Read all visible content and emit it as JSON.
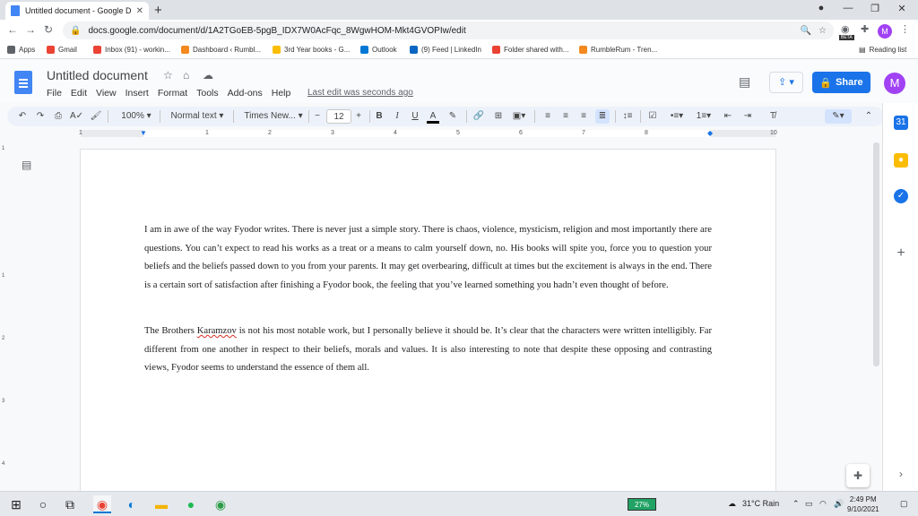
{
  "browser": {
    "tab_title": "Untitled document - Google Docs",
    "tab_close": "✕",
    "new_tab": "+",
    "url": "docs.google.com/document/d/1A2TGoEB-5pgB_IDX7W0AcFqc_8WgwHOM-Mkt4GVOPIw/edit",
    "profile_initial": "M",
    "beta_badge": "BETA",
    "reading_list": "Reading list"
  },
  "bookmarks": [
    {
      "label": "Apps",
      "color": "#5f6368"
    },
    {
      "label": "Gmail",
      "color": "#ea4335"
    },
    {
      "label": "Inbox (91) - workin...",
      "color": "#ea4335"
    },
    {
      "label": "Dashboard ‹ Rumbl...",
      "color": "#f4891f"
    },
    {
      "label": "3rd Year books - G...",
      "color": "#fbbc04"
    },
    {
      "label": "Outlook",
      "color": "#0078d4"
    },
    {
      "label": "(9) Feed | LinkedIn",
      "color": "#0a66c2"
    },
    {
      "label": "Folder shared with...",
      "color": "#ea4335"
    },
    {
      "label": "RumbleRum - Tren...",
      "color": "#f4891f"
    }
  ],
  "docs": {
    "title": "Untitled document",
    "menu": [
      "File",
      "Edit",
      "View",
      "Insert",
      "Format",
      "Tools",
      "Add-ons",
      "Help"
    ],
    "last_edit": "Last edit was seconds ago",
    "share_label": "Share",
    "avatar_initial": "M"
  },
  "toolbar": {
    "zoom": "100%",
    "style": "Normal text",
    "font": "Times New...",
    "font_size": "12",
    "bold": "B",
    "italic": "I",
    "underline": "U",
    "text_color": "A"
  },
  "ruler": [
    "1",
    "1",
    "2",
    "3",
    "4",
    "5",
    "6",
    "7",
    "8",
    "9",
    "10"
  ],
  "vruler": [
    "1",
    "1",
    "2",
    "3",
    "4"
  ],
  "document": {
    "para1": "I am in awe of the way Fyodor writes. There is never just a simple story. There is chaos, violence, mysticism, religion and most importantly there are questions. You can’t expect to read his works as a treat or a means to calm yourself down, no. His books will spite you, force you to question your beliefs and the beliefs passed down to you from your parents. It may get overbearing, difficult at times but the excitement is always in the end. There is a certain sort of satisfaction after finishing a Fyodor book, the feeling that you’ve learned something you hadn’t even thought of before.",
    "para2_before": "The Brothers ",
    "para2_misspelled": "Karamzov",
    "para2_after": " is not his most notable work, but I personally believe it should be. It’s clear that the characters were written intelligibly. Far different from one another in respect to their beliefs, morals and values. It is also interesting to note that despite these opposing and contrasting views, Fyodor seems to understand the essence of them all."
  },
  "taskbar": {
    "battery": "27%",
    "weather": "31°C  Rain",
    "time": "2:49 PM",
    "date": "9/10/2021"
  }
}
